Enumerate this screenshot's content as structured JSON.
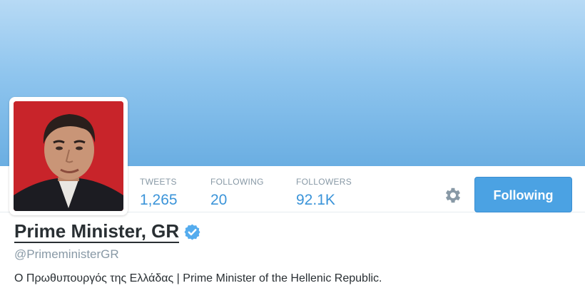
{
  "profile": {
    "name": "Prime Minister, GR",
    "handle": "@PrimeministerGR",
    "bio": "Ο Πρωθυπουργός της Ελλάδας | Prime Minister of the Hellenic Republic.",
    "verified": true
  },
  "stats": {
    "tweets": {
      "label": "TWEETS",
      "value": "1,265"
    },
    "following": {
      "label": "FOLLOWING",
      "value": "20"
    },
    "followers": {
      "label": "FOLLOWERS",
      "value": "92.1K"
    }
  },
  "actions": {
    "follow_label": "Following",
    "settings_icon": "gear-icon",
    "verified_icon": "verified-badge-icon"
  },
  "colors": {
    "accent": "#3b94d9",
    "button": "#4ba2e3",
    "header_top": "#b7daf5",
    "header_bottom": "#6aaee2",
    "muted": "#8899a6",
    "text": "#292f33"
  }
}
